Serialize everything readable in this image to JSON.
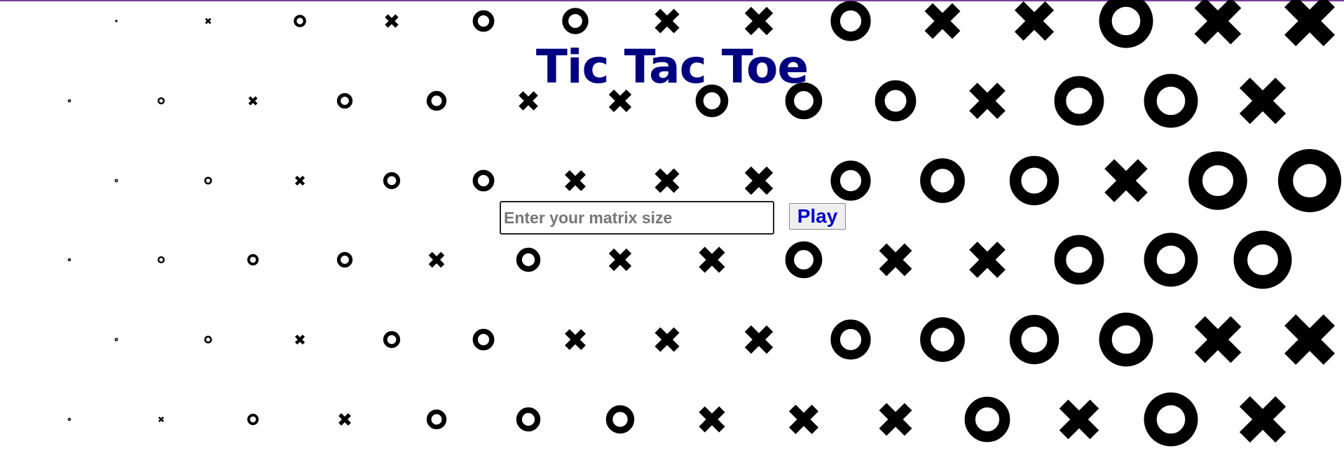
{
  "page": {
    "title": "Tic Tac Toe"
  },
  "form": {
    "size_input": {
      "value": "",
      "placeholder": "Enter your matrix size"
    },
    "play_label": "Play"
  },
  "background": {
    "rows": [
      "xxoxooxxoxxoxx",
      "ooxooxxoooxoox",
      "ooxooxxxoooxoo",
      "ooooxoxxoxxooo",
      "ooxooxxxooooxx",
      "oxoxoooxxxoxox"
    ]
  },
  "colors": {
    "title": "#000080",
    "play_text": "#0000cc",
    "pattern": "#000000",
    "top_border": "#7b3f98"
  }
}
